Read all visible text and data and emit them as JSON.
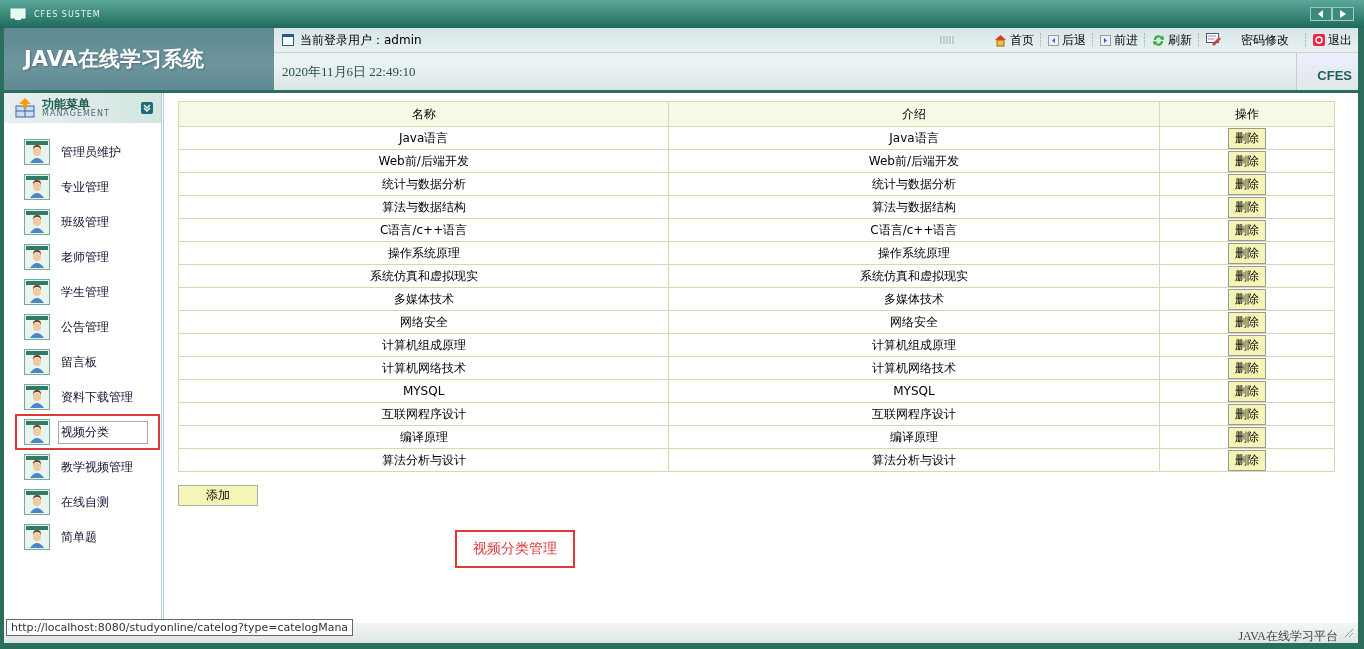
{
  "window": {
    "title": "CFES SUSTEM"
  },
  "header": {
    "system_title": "JAVA在线学习系统",
    "user_label": "当前登录用户：",
    "user": "admin",
    "datetime": "2020年11月6日 22:49:10",
    "brand": "CFES",
    "nav": [
      {
        "kind": "home",
        "label": "首页"
      },
      {
        "kind": "back",
        "label": "后退"
      },
      {
        "kind": "forward",
        "label": "前进"
      },
      {
        "kind": "refresh",
        "label": "刷新"
      },
      {
        "kind": "edit",
        "label": "密码修改"
      },
      {
        "kind": "exit",
        "label": "退出"
      }
    ]
  },
  "sidebar": {
    "title": "功能菜单",
    "subtitle": "MANAGEMENT",
    "items": [
      {
        "label": "管理员维护",
        "selected": false,
        "annotated": false
      },
      {
        "label": "专业管理",
        "selected": false,
        "annotated": false
      },
      {
        "label": "班级管理",
        "selected": false,
        "annotated": false
      },
      {
        "label": "老师管理",
        "selected": false,
        "annotated": false
      },
      {
        "label": "学生管理",
        "selected": false,
        "annotated": false
      },
      {
        "label": "公告管理",
        "selected": false,
        "annotated": false
      },
      {
        "label": "留言板",
        "selected": false,
        "annotated": false
      },
      {
        "label": "资料下载管理",
        "selected": false,
        "annotated": false
      },
      {
        "label": "视频分类",
        "selected": true,
        "annotated": true
      },
      {
        "label": "教学视频管理",
        "selected": false,
        "annotated": false
      },
      {
        "label": "在线自测",
        "selected": false,
        "annotated": false
      },
      {
        "label": "简单题",
        "selected": false,
        "annotated": false
      }
    ]
  },
  "table": {
    "columns": [
      "名称",
      "介绍",
      "操作"
    ],
    "rows": [
      {
        "name": "Java语言",
        "intro": "Java语言",
        "action": "删除"
      },
      {
        "name": "Web前/后端开发",
        "intro": "Web前/后端开发",
        "action": "删除"
      },
      {
        "name": "统计与数据分析",
        "intro": "统计与数据分析",
        "action": "删除"
      },
      {
        "name": "算法与数据结构",
        "intro": "算法与数据结构",
        "action": "删除"
      },
      {
        "name": "C语言/c++语言",
        "intro": "C语言/c++语言",
        "action": "删除"
      },
      {
        "name": "操作系统原理",
        "intro": "操作系统原理",
        "action": "删除"
      },
      {
        "name": "系统仿真和虚拟现实",
        "intro": "系统仿真和虚拟现实",
        "action": "删除"
      },
      {
        "name": "多媒体技术",
        "intro": "多媒体技术",
        "action": "删除"
      },
      {
        "name": "网络安全",
        "intro": "网络安全",
        "action": "删除"
      },
      {
        "name": "计算机组成原理",
        "intro": "计算机组成原理",
        "action": "删除"
      },
      {
        "name": "计算机网络技术",
        "intro": "计算机网络技术",
        "action": "删除"
      },
      {
        "name": "MYSQL",
        "intro": "MYSQL",
        "action": "删除"
      },
      {
        "name": "互联网程序设计",
        "intro": "互联网程序设计",
        "action": "删除"
      },
      {
        "name": "编译原理",
        "intro": "编译原理",
        "action": "删除"
      },
      {
        "name": "算法分析与设计",
        "intro": "算法分析与设计",
        "action": "删除"
      }
    ]
  },
  "add_button": "添加",
  "annotation": "视频分类管理",
  "status_bar": {
    "url": "http://localhost:8080/studyonline/catelog?type=catelogMana",
    "footer": "JAVA在线学习平台"
  }
}
